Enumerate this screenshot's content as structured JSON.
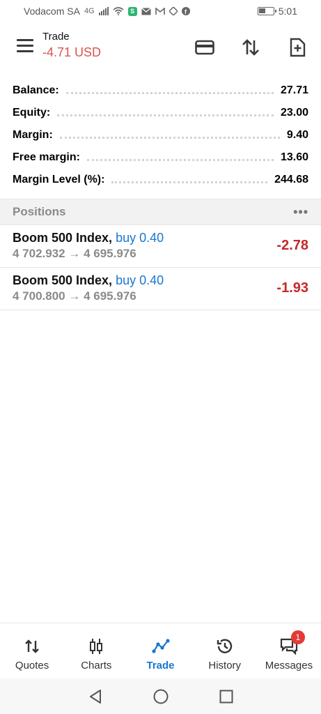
{
  "status_bar": {
    "carrier": "Vodacom SA",
    "network": "4G",
    "time": "5:01"
  },
  "header": {
    "title": "Trade",
    "profit": "-4.71 USD"
  },
  "summary": [
    {
      "label": "Balance:",
      "value": "27.71"
    },
    {
      "label": "Equity:",
      "value": "23.00"
    },
    {
      "label": "Margin:",
      "value": "9.40"
    },
    {
      "label": "Free margin:",
      "value": "13.60"
    },
    {
      "label": "Margin Level (%):",
      "value": "244.68"
    }
  ],
  "positions_section": {
    "title": "Positions",
    "more": "•••"
  },
  "positions": [
    {
      "symbol": "Boom 500 Index,",
      "side": "buy 0.40",
      "prices": "4 702.932 → 4 695.976",
      "profit": "-2.78"
    },
    {
      "symbol": "Boom 500 Index,",
      "side": "buy 0.40",
      "prices": "4 700.800 → 4 695.976",
      "profit": "-1.93"
    }
  ],
  "bottom_nav": [
    {
      "label": "Quotes",
      "icon": "quotes-icon"
    },
    {
      "label": "Charts",
      "icon": "charts-icon"
    },
    {
      "label": "Trade",
      "icon": "trade-icon"
    },
    {
      "label": "History",
      "icon": "history-icon"
    },
    {
      "label": "Messages",
      "icon": "messages-icon",
      "badge": "1"
    }
  ],
  "colors": {
    "accent": "#1976d2",
    "loss": "#c62828",
    "header_loss": "#d9534f"
  }
}
